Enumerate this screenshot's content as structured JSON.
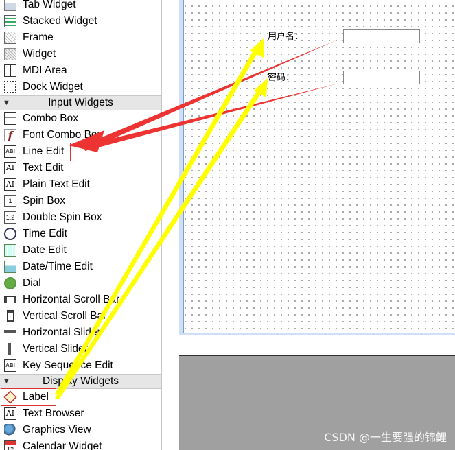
{
  "widget_box": {
    "containers_tail": [
      {
        "label": "Tab Widget",
        "icon": "tab-widget-icon"
      },
      {
        "label": "Stacked Widget",
        "icon": "stacked-widget-icon"
      },
      {
        "label": "Frame",
        "icon": "frame-icon"
      },
      {
        "label": "Widget",
        "icon": "widget-icon"
      },
      {
        "label": "MDI Area",
        "icon": "mdi-area-icon"
      },
      {
        "label": "Dock Widget",
        "icon": "dock-widget-icon"
      }
    ],
    "input_category": "Input Widgets",
    "input_widgets": [
      {
        "label": "Combo Box",
        "icon": "combo-box-icon"
      },
      {
        "label": "Font Combo Box",
        "icon": "font-combo-box-icon"
      },
      {
        "label": "Line Edit",
        "icon": "line-edit-icon"
      },
      {
        "label": "Text Edit",
        "icon": "text-edit-icon"
      },
      {
        "label": "Plain Text Edit",
        "icon": "plain-text-edit-icon"
      },
      {
        "label": "Spin Box",
        "icon": "spin-box-icon"
      },
      {
        "label": "Double Spin Box",
        "icon": "double-spin-box-icon"
      },
      {
        "label": "Time Edit",
        "icon": "time-edit-icon"
      },
      {
        "label": "Date Edit",
        "icon": "date-edit-icon"
      },
      {
        "label": "Date/Time Edit",
        "icon": "date-time-edit-icon"
      },
      {
        "label": "Dial",
        "icon": "dial-icon"
      },
      {
        "label": "Horizontal Scroll Bar",
        "icon": "horizontal-scroll-bar-icon"
      },
      {
        "label": "Vertical Scroll Bar",
        "icon": "vertical-scroll-bar-icon"
      },
      {
        "label": "Horizontal Slider",
        "icon": "horizontal-slider-icon"
      },
      {
        "label": "Vertical Slider",
        "icon": "vertical-slider-icon"
      },
      {
        "label": "Key Sequence Edit",
        "icon": "key-sequence-edit-icon"
      }
    ],
    "display_category": "Display Widgets",
    "display_widgets": [
      {
        "label": "Label",
        "icon": "label-icon"
      },
      {
        "label": "Text Browser",
        "icon": "text-browser-icon"
      },
      {
        "label": "Graphics View",
        "icon": "graphics-view-icon"
      },
      {
        "label": "Calendar Widget",
        "icon": "calendar-widget-icon"
      }
    ],
    "icon_glyphs": {
      "line_edit": "ABI",
      "text_edit": "AI",
      "plain_text_edit": "AI",
      "spin_box": "1",
      "double_spin_box": "1.2",
      "key_sequence_edit": "ABI",
      "text_browser": "AI",
      "calendar_widget": "12",
      "font_combo_box": "f"
    }
  },
  "form": {
    "username_label": "用户名：",
    "password_label": "密码：",
    "username_value": "",
    "password_value": ""
  },
  "annotations": {
    "red_arrow_color": "#ee3333",
    "yellow_arrow_color": "#ffff00",
    "highlight_color": "#e03030"
  },
  "watermark": "CSDN @一生要强的锦鲤"
}
